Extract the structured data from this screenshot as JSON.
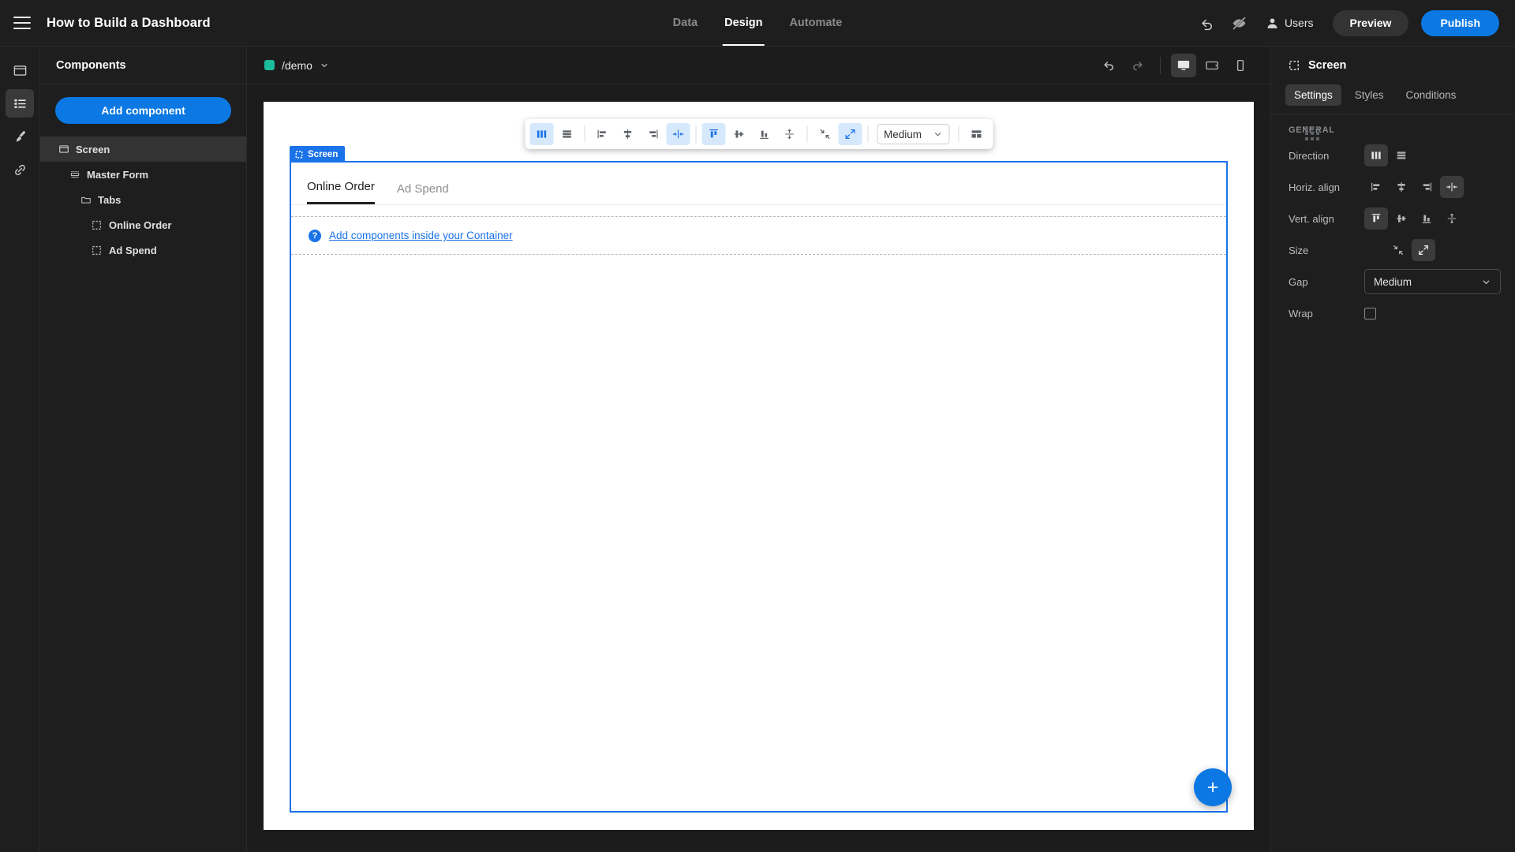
{
  "topbar": {
    "menu_icon": "hamburger-icon",
    "title": "How to Build a Dashboard",
    "nav_tabs": [
      {
        "label": "Data",
        "active": false
      },
      {
        "label": "Design",
        "active": true
      },
      {
        "label": "Automate",
        "active": false
      }
    ],
    "undo_icon": "undo-icon",
    "preview_off_icon": "eye-slash-icon",
    "users_label": "Users",
    "preview_label": "Preview",
    "publish_label": "Publish",
    "publish_color": "#0b78e3"
  },
  "rail": {
    "items": [
      {
        "icon": "screen-icon",
        "active": false
      },
      {
        "icon": "components-list-icon",
        "active": true
      },
      {
        "icon": "brush-icon",
        "active": false
      },
      {
        "icon": "link-icon",
        "active": false
      }
    ]
  },
  "components_panel": {
    "header": "Components",
    "add_button": "Add component",
    "tree": [
      {
        "label": "Screen",
        "icon": "screen-icon",
        "depth": 0,
        "selected": true
      },
      {
        "label": "Master Form",
        "icon": "form-icon",
        "depth": 1,
        "selected": false
      },
      {
        "label": "Tabs",
        "icon": "folder-icon",
        "depth": 2,
        "selected": false
      },
      {
        "label": "Online Order",
        "icon": "container-icon",
        "depth": 3,
        "selected": false
      },
      {
        "label": "Ad Spend",
        "icon": "container-icon",
        "depth": 3,
        "selected": false
      }
    ]
  },
  "canvas_toolbar": {
    "route_label": "/demo",
    "route_dot_color": "#1abc9c",
    "route_chevron": "chevron-down-icon",
    "undo_icon": "undo-icon",
    "redo_icon": "redo-icon",
    "devices": [
      {
        "icon": "desktop-icon",
        "active": true
      },
      {
        "icon": "tablet-icon",
        "active": false
      },
      {
        "icon": "mobile-icon",
        "active": false
      }
    ]
  },
  "float_toolbar": {
    "direction": [
      {
        "icon": "direction-columns-icon",
        "active": true
      },
      {
        "icon": "direction-rows-icon",
        "active": false
      }
    ],
    "horiz_align": [
      {
        "icon": "align-left-icon",
        "active": false
      },
      {
        "icon": "align-center-icon",
        "active": false
      },
      {
        "icon": "align-right-icon",
        "active": false
      },
      {
        "icon": "align-space-between-icon",
        "active": true
      }
    ],
    "vert_align": [
      {
        "icon": "align-top-icon",
        "active": true
      },
      {
        "icon": "align-middle-icon",
        "active": false
      },
      {
        "icon": "align-bottom-icon",
        "active": false
      },
      {
        "icon": "align-stretch-vertical-icon",
        "active": false
      }
    ],
    "size": [
      {
        "icon": "size-shrink-icon",
        "active": false
      },
      {
        "icon": "size-grow-icon",
        "active": true
      }
    ],
    "gap_value": "Medium",
    "gap_chevron": "chevron-down-icon",
    "layout_icon": "layout-grid-icon",
    "drag_handle_icon": "drag-dots-icon"
  },
  "canvas": {
    "screen_badge": "Screen",
    "screen_badge_icon": "container-icon",
    "tabs": [
      {
        "label": "Online Order",
        "active": true
      },
      {
        "label": "Ad Spend",
        "active": false
      }
    ],
    "slot_help_icon": "question-icon",
    "slot_link": "Add components inside your Container",
    "fab_icon": "plus-icon",
    "selection_color": "#1a73e8"
  },
  "properties_panel": {
    "title": "Screen",
    "title_icon": "container-icon",
    "tabs": [
      {
        "label": "Settings",
        "active": true
      },
      {
        "label": "Styles",
        "active": false
      },
      {
        "label": "Conditions",
        "active": false
      }
    ],
    "section_title": "GENERAL",
    "rows": {
      "direction_label": "Direction",
      "direction_options": [
        {
          "icon": "direction-columns-icon",
          "active": true
        },
        {
          "icon": "direction-rows-icon",
          "active": false
        }
      ],
      "horiz_label": "Horiz. align",
      "horiz_options": [
        {
          "icon": "align-left-icon",
          "active": false
        },
        {
          "icon": "align-center-icon",
          "active": false
        },
        {
          "icon": "align-right-icon",
          "active": false
        },
        {
          "icon": "align-space-between-icon",
          "active": true
        }
      ],
      "vert_label": "Vert. align",
      "vert_options": [
        {
          "icon": "align-top-icon",
          "active": true
        },
        {
          "icon": "align-middle-icon",
          "active": false
        },
        {
          "icon": "align-bottom-icon",
          "active": false
        },
        {
          "icon": "align-stretch-vertical-icon",
          "active": false
        }
      ],
      "size_label": "Size",
      "size_options": [
        {
          "icon": "size-shrink-icon",
          "active": false
        },
        {
          "icon": "size-grow-icon",
          "active": true
        }
      ],
      "gap_label": "Gap",
      "gap_value": "Medium",
      "gap_chevron": "chevron-down-icon",
      "wrap_label": "Wrap",
      "wrap_checked": false
    }
  }
}
